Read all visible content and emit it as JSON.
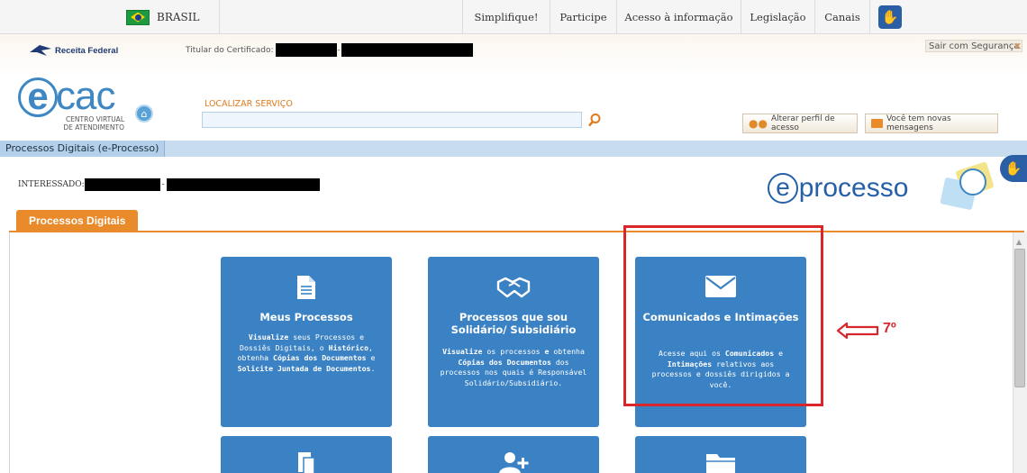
{
  "govbar": {
    "country": "BRASIL",
    "links": [
      "Simplifique!",
      "Participe",
      "Acesso à informação",
      "Legislação",
      "Canais"
    ]
  },
  "header": {
    "rf_logo": "Receita Federal",
    "cert_label": "Titular do Certificado:",
    "exit_label": "Sair com Segurança",
    "exit_x": "x",
    "ecac_e": "e",
    "ecac_cac": "cac",
    "ecac_sub1": "CENTRO VIRTUAL",
    "ecac_sub2": "DE ATENDIMENTO",
    "search_label": "LOCALIZAR SERVIÇO",
    "search_value": "",
    "profile_btn": "Alterar perfil de acesso",
    "messages_btn": "Você tem novas mensagens"
  },
  "breadcrumb": "Processos Digitais (e-Processo)",
  "interessado_label": "INTERESSADO:",
  "eprocesso": {
    "e": "e",
    "text": "processo"
  },
  "tab": "Processos Digitais",
  "cards": [
    {
      "title": "Meus Processos",
      "desc_html": "<b>Visualize</b> seus Processos e Dossiês Digitais, o <b>Histórico</b>, obtenha <b>Cópias dos Documentos</b> e <b>Solicite Juntada de Documentos</b>."
    },
    {
      "title": "Processos que sou Solidário/ Subsidiário",
      "desc_html": "<b>Visualize</b> os processos <b>e</b> obtenha <b>Cópias dos Documentos</b> dos processos nos quais é Responsável Solidário/Subsidiário."
    },
    {
      "title": "Comunicados e Intimações",
      "desc_html": "Acesse aqui os <b>Comunicados</b> e <b>Intimações</b> relativos aos processos e dossiês dirigidos a você."
    }
  ],
  "annotation": "7º",
  "colors": {
    "card_blue": "#3b82c4",
    "tab_orange": "#e98a2b",
    "highlight_red": "#d8262b"
  }
}
